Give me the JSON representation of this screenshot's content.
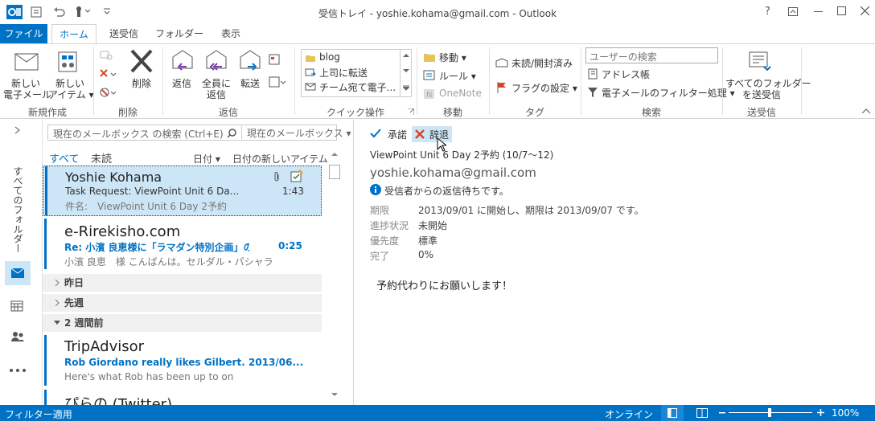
{
  "window": {
    "title": "受信トレイ - yoshie.kohama@gmail.com - Outlook",
    "help": "?"
  },
  "tabs": [
    {
      "label": "ファイル"
    },
    {
      "label": "ホーム"
    },
    {
      "label": "送受信"
    },
    {
      "label": "フォルダー"
    },
    {
      "label": "表示"
    }
  ],
  "ribbon": {
    "new_group": {
      "label": "新規作成",
      "new_mail": "新しい\n電子メール",
      "new_items": "新しい\nアイテム ▾"
    },
    "delete_group": {
      "label": "削除",
      "delete": "削除"
    },
    "respond_group": {
      "label": "返信",
      "reply": "返信",
      "reply_all": "全員に\n返信",
      "forward": "転送"
    },
    "quicksteps_group": {
      "label": "クイック操作",
      "items": [
        "blog",
        "上司に転送",
        "チーム宛て電子..."
      ]
    },
    "move_group": {
      "label": "移動",
      "move": "移動 ▾",
      "rules": "ルール ▾",
      "onenote": "OneNote"
    },
    "tags_group": {
      "label": "タグ",
      "unread": "未読/開封済み",
      "flag": "フラグの設定 ▾"
    },
    "find_group": {
      "label": "検索",
      "search_people_placeholder": "ユーザーの検索",
      "address_book": "アドレス帳",
      "filter_email": "電子メールのフィルター処理 ▾"
    },
    "sendreceive_group": {
      "label": "送受信",
      "send_all": "すべてのフォルダー\nを送受信"
    }
  },
  "leftnav": {
    "folder_label": "すべてのフォルダー"
  },
  "list": {
    "search_placeholder": "現在のメールボックス の検索 (Ctrl+E)",
    "scope": "現在のメールボックス",
    "filter_all": "すべて",
    "filter_unread": "未読",
    "sort_by": "日付 ▾",
    "sort_order": "日付の新しいアイテム ↓",
    "mails": [
      {
        "sender": "Yoshie Kohama",
        "subject": "Task Request: ViewPoint Unit 6 Da...",
        "time": "1:43",
        "preview": "件名:　ViewPoint Unit 6 Day 2予約"
      },
      {
        "sender": "e-Rirekisho.com",
        "subject": "Re: 小濱 良恵様に「ラマダン特別企画」の...",
        "time": "0:25",
        "preview": "小濱 良恵　様 こんばんは。セルダル・パシャラ"
      }
    ],
    "groups": [
      {
        "label": "昨日"
      },
      {
        "label": "先週"
      },
      {
        "label": "2 週間前"
      }
    ],
    "mails2": [
      {
        "sender": "TripAdvisor",
        "subject": "Rob Giordano really likes Gilbert...",
        "time": "2013/06...",
        "preview": "Here's what Rob has been up to on"
      },
      {
        "sender": "ぴらの (Twitter)"
      }
    ]
  },
  "reading": {
    "accept": "承諾",
    "decline": "辞退",
    "subject": "ViewPoint Unit 6 Day 2予約 (10/7～12)",
    "from": "yoshie.kohama@gmail.com",
    "info": "受信者からの返信待ちです。",
    "fields": [
      {
        "label": "期限",
        "value": "2013/09/01 に開始し、期限は 2013/09/07 です。"
      },
      {
        "label": "進捗状況",
        "value": "未開始"
      },
      {
        "label": "優先度",
        "value": "標準"
      },
      {
        "label": "完了",
        "value": "0%"
      }
    ],
    "body": "予約代わりにお願いします！"
  },
  "status": {
    "left": "フィルター適用",
    "online": "オンライン",
    "zoom": "100%"
  }
}
